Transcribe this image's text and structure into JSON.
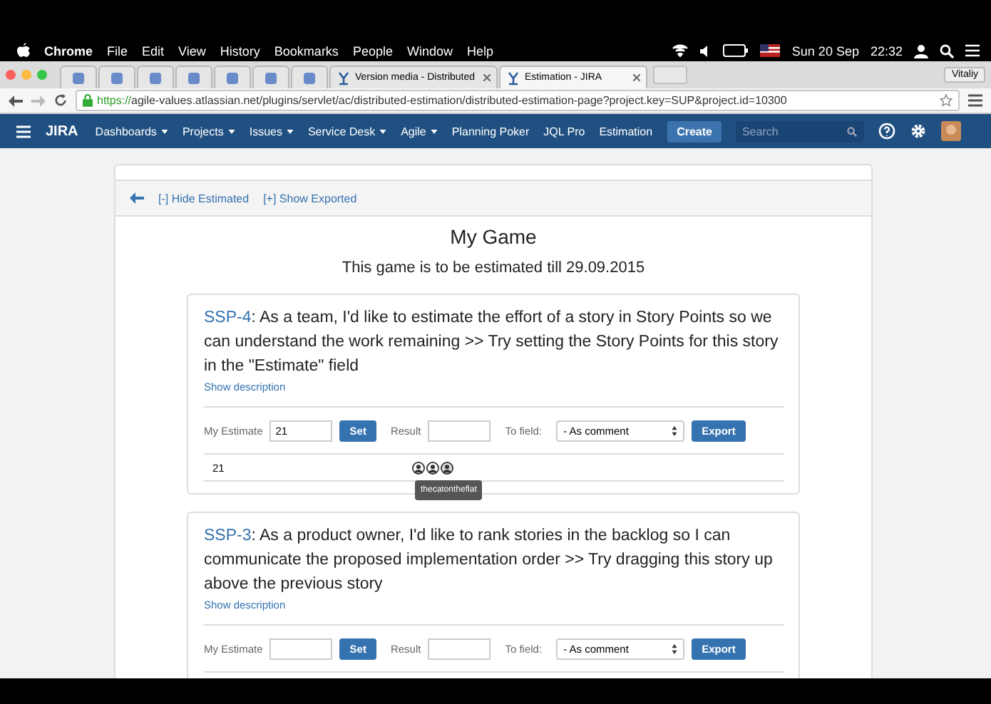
{
  "os_menu_bar": {
    "app": "Chrome",
    "menus": [
      "File",
      "Edit",
      "View",
      "History",
      "Bookmarks",
      "People",
      "Window",
      "Help"
    ],
    "date": "Sun 20 Sep",
    "time": "22:32"
  },
  "browser": {
    "tabs": [
      {
        "kind": "pinned",
        "selected": false
      },
      {
        "kind": "pinned",
        "selected": false
      },
      {
        "kind": "pinned",
        "selected": false
      },
      {
        "kind": "pinned",
        "selected": false
      },
      {
        "kind": "pinned",
        "selected": false
      },
      {
        "kind": "pinned",
        "selected": false
      },
      {
        "kind": "pinned",
        "selected": false
      },
      {
        "kind": "page",
        "title": "Version media - Distributed",
        "selected": false
      },
      {
        "kind": "page",
        "title": "Estimation - JIRA",
        "selected": true
      }
    ],
    "profile": "Vitaliy",
    "url_scheme": "https://",
    "url_rest": "agile-values.atlassian.net/plugins/servlet/ac/distributed-estimation/distributed-estimation-page?project.key=SUP&project.id=10300"
  },
  "jira_nav": {
    "logo": "JIRA",
    "items": [
      {
        "label": "Dashboards",
        "dropdown": true
      },
      {
        "label": "Projects",
        "dropdown": true
      },
      {
        "label": "Issues",
        "dropdown": true
      },
      {
        "label": "Service Desk",
        "dropdown": true
      },
      {
        "label": "Agile",
        "dropdown": true
      },
      {
        "label": "Planning Poker",
        "dropdown": false
      },
      {
        "label": "JQL Pro",
        "dropdown": false
      },
      {
        "label": "Estimation",
        "dropdown": false
      }
    ],
    "create": "Create",
    "search": {
      "placeholder": "Search"
    }
  },
  "game": {
    "links": [
      "[-] Hide Estimated",
      "[+] Show Exported"
    ],
    "title": "My Game",
    "subtitle": "This game is to be estimated till 29.09.2015",
    "issues": [
      {
        "key": "SSP-4",
        "summary": ": As a team, I'd like to estimate the effort of a story in Story Points so we can understand the work remaining >> Try setting the Story Points for this story in the \"Estimate\" field",
        "show_description": "Show description",
        "estimate_label": "My Estimate",
        "estimate_value": "21",
        "set": "Set",
        "result_label": "Result",
        "to_field_label": "To field:",
        "to_field_value": "- As comment",
        "export": "Export",
        "votes": [
          {
            "value": "21",
            "tooltip": "thecatontheflat",
            "voters": [
              {
                "hovered": false
              },
              {
                "hovered": false
              },
              {
                "hovered": true
              }
            ]
          }
        ]
      },
      {
        "key": "SSP-3",
        "summary": ": As a product owner, I'd like to rank stories in the backlog so I can communicate the proposed implementation order >> Try dragging this story up above the previous story",
        "show_description": "Show description",
        "estimate_label": "My Estimate",
        "set": "Set",
        "result_label": "Result",
        "to_field_label": "To field:",
        "to_field_value": "- As comment",
        "export": "Export"
      }
    ]
  }
}
